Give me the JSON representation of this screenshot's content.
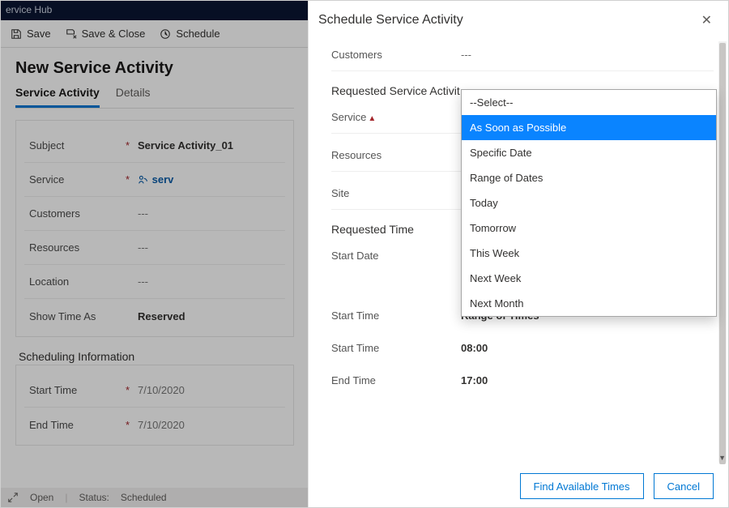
{
  "app": {
    "title": "ervice Hub"
  },
  "commandbar": {
    "save": "Save",
    "save_close": "Save & Close",
    "schedule": "Schedule"
  },
  "page": {
    "title": "New Service Activity",
    "tabs": {
      "activity": "Service Activity",
      "details": "Details"
    }
  },
  "form": {
    "subject_label": "Subject",
    "subject_value": "Service Activity_01",
    "service_label": "Service",
    "service_value": "serv",
    "customers_label": "Customers",
    "customers_value": "---",
    "resources_label": "Resources",
    "resources_value": "---",
    "location_label": "Location",
    "location_value": "---",
    "showtime_label": "Show Time As",
    "showtime_value": "Reserved"
  },
  "sched_section": {
    "heading": "Scheduling Information",
    "start_label": "Start Time",
    "start_value": "7/10/2020",
    "end_label": "End Time",
    "end_value": "7/10/2020"
  },
  "statusbar": {
    "open": "Open",
    "status_label": "Status:",
    "status_value": "Scheduled"
  },
  "panel": {
    "title": "Schedule Service Activity",
    "customers_label": "Customers",
    "customers_value": "---",
    "section_activity": "Requested Service Activit",
    "service_label": "Service",
    "service_value": "",
    "resources_label": "Resources",
    "resources_value": "",
    "site_label": "Site",
    "site_value": "",
    "section_time": "Requested Time",
    "startdate_label": "Start Date",
    "startdate_value": "As Soon as Possible",
    "starttime_label": "Start Time",
    "starttime_value": "Range of Times",
    "starttime2_label": "Start Time",
    "starttime2_value": "08:00",
    "endtime_label": "End Time",
    "endtime_value": "17:00",
    "find_btn": "Find Available Times",
    "cancel_btn": "Cancel"
  },
  "dropdown": {
    "options": [
      "--Select--",
      "As Soon as Possible",
      "Specific Date",
      "Range of Dates",
      "Today",
      "Tomorrow",
      "This Week",
      "Next Week",
      "Next Month"
    ],
    "highlight_index": 1
  }
}
